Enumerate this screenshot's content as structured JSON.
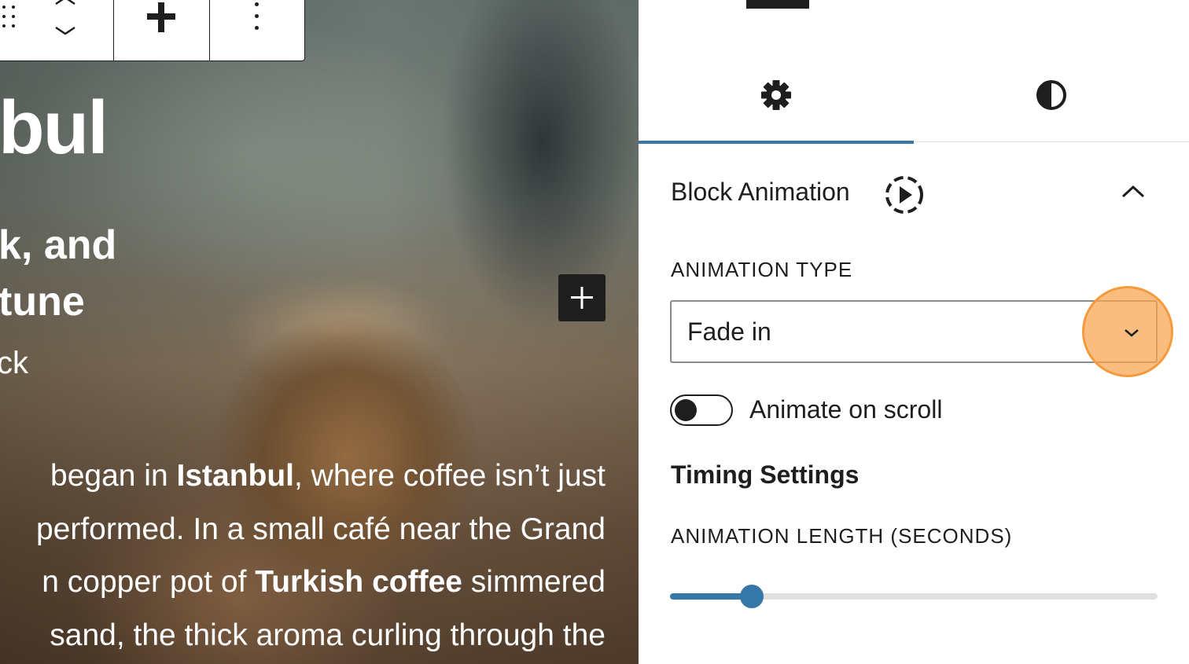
{
  "canvas": {
    "hero_title": "bul",
    "hero_subtitle": "k, and\ntune",
    "hero_small": "ck",
    "body_lines": [
      [
        {
          "t": "began in "
        },
        {
          "t": "Istanbul",
          "b": true
        },
        {
          "t": ", where coffee isn’t just"
        }
      ],
      [
        {
          "t": "performed. In a small café near the Grand"
        }
      ],
      [
        {
          "t": "n copper pot of "
        },
        {
          "t": "Turkish coffee",
          "b": true
        },
        {
          "t": " simmered"
        }
      ],
      [
        {
          "t": "sand, the thick aroma curling through the"
        }
      ]
    ],
    "toolbar": {
      "drag_icon": "drag-handle-icon",
      "mover_icon": "move-up-down-icon",
      "align_icon": "plus-icon",
      "more_icon": "more-options-icon"
    },
    "block_inserter_icon": "plus-icon"
  },
  "sidebar": {
    "tabs": [
      {
        "id": "settings",
        "icon": "gear-icon",
        "active": true
      },
      {
        "id": "styles",
        "icon": "contrast-icon",
        "active": false
      }
    ],
    "panel": {
      "title": "Block Animation",
      "title_icon": "animation-play-icon",
      "expanded": true,
      "animation_type_label": "Animation Type",
      "animation_type_value": "Fade in",
      "animate_on_scroll_label": "Animate on scroll",
      "animate_on_scroll": false,
      "timing_title": "Timing Settings",
      "animation_length_label": "Animation Length (Seconds)",
      "animation_length_fraction": 0.168
    }
  },
  "colors": {
    "accent": "#3578a8",
    "text": "#1e1e1e",
    "highlight": "#f7a44f"
  }
}
